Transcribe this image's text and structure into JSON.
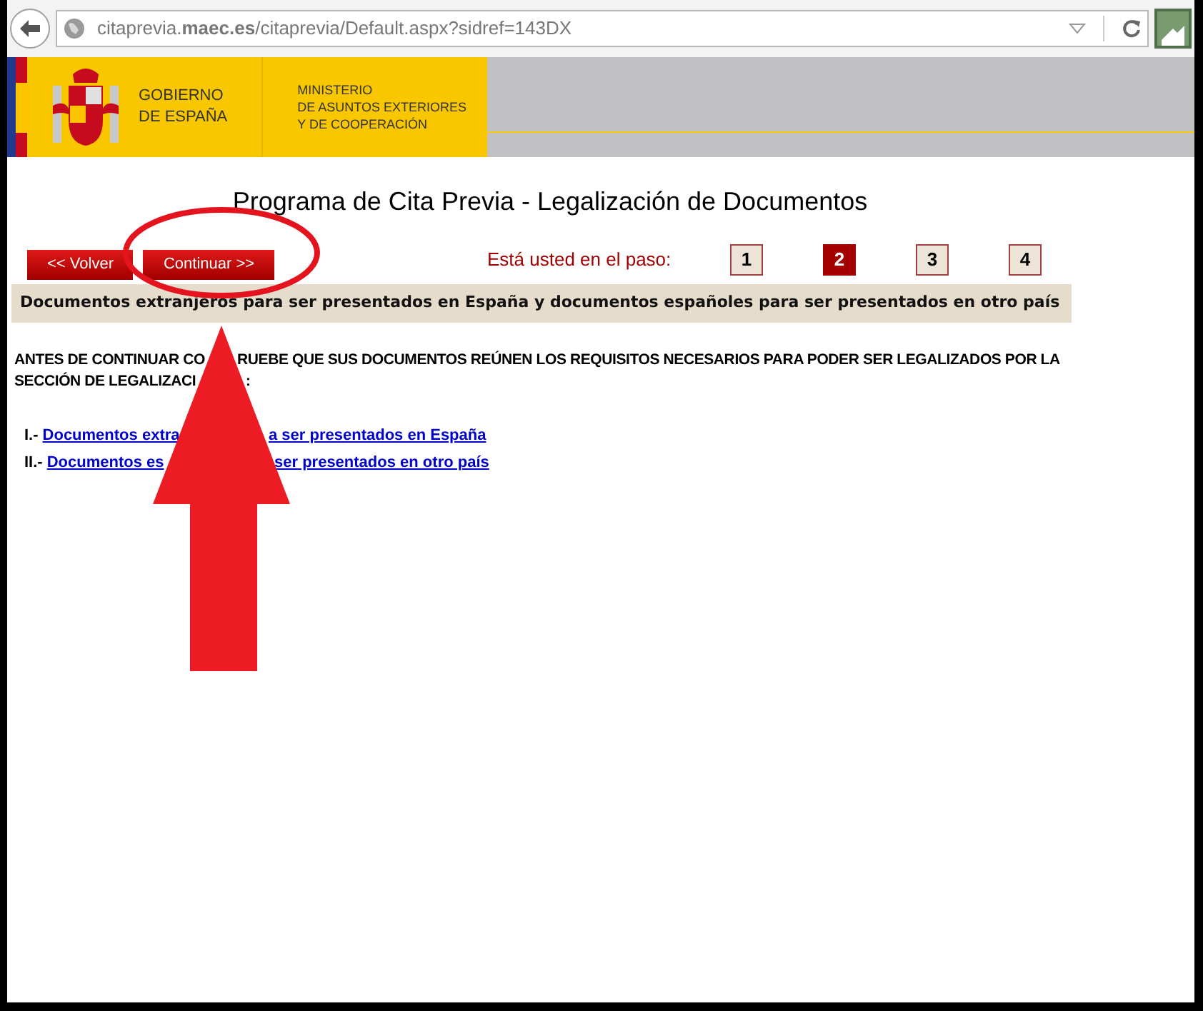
{
  "browser": {
    "url": "citaprevia.**maec.es**/citaprevia/Default.aspx?sidref=143DX"
  },
  "header": {
    "government": [
      "GOBIERNO",
      "DE ESPAÑA"
    ],
    "ministry": [
      "MINISTERIO",
      "DE ASUNTOS EXTERIORES",
      "Y DE COOPERACIÓN"
    ]
  },
  "page": {
    "title": "Programa de Cita Previa - Legalización de Documentos",
    "buttons": [
      "<< Volver",
      "Continuar >>"
    ],
    "step_label": "Está usted en el paso:",
    "steps": [
      {
        "label": "1",
        "selected": false
      },
      {
        "label": "2",
        "selected": true
      },
      {
        "label": "3",
        "selected": false
      },
      {
        "label": "4",
        "selected": false
      }
    ],
    "section_title": "Documentos extranjeros para ser presentados en España y documentos españoles para ser presentados en otro país",
    "notice_lines": [
      [
        "ANTES DE CONTINUAR CO",
        "RUEBE QUE SUS DOCUMENTOS REÚNEN LOS REQUISITOS NECESARIOS PARA PODER SER LEGALIZADOS POR LA"
      ],
      [
        "SECCIÓN DE LEGALIZACI",
        ":"
      ]
    ],
    "links": [
      {
        "marker": "I.-",
        "parts": [
          "Documentos extra",
          "a ser presentados en España"
        ]
      },
      {
        "marker": "II.-",
        "parts": [
          "Documentos es",
          "ser presentados en otro país"
        ]
      }
    ]
  },
  "annotation": {
    "kind": "arrow"
  }
}
